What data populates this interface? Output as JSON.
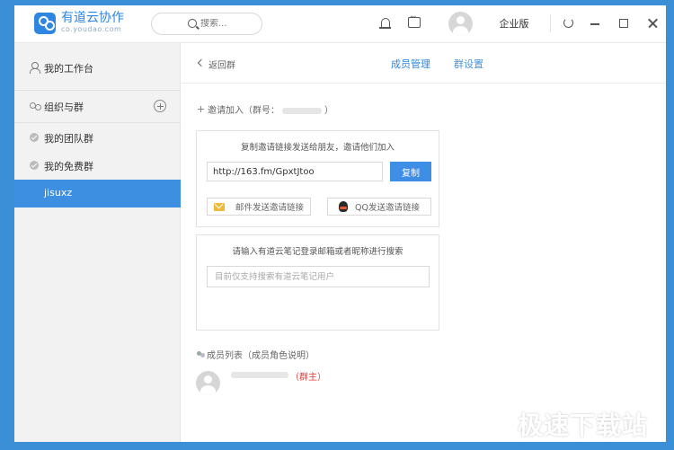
{
  "app": {
    "logo_title": "有道云协作",
    "logo_sub": "co.youdao.com",
    "search_placeholder": "搜索...",
    "edition_label": "企业版"
  },
  "sidebar": {
    "workspace": "我的工作台",
    "org_groups": "组织与群",
    "items": [
      {
        "label": "我的团队群"
      },
      {
        "label": "我的免费群"
      },
      {
        "label": "jisuxz"
      }
    ]
  },
  "main": {
    "back_label": "返回群",
    "tabs": [
      {
        "label": "成员管理"
      },
      {
        "label": "群设置"
      }
    ],
    "invite": {
      "title_prefix": "邀请加入（群号：",
      "title_suffix": "）",
      "link_caption": "复制邀请链接发送给朋友，邀请他们加入",
      "link_value": "http://163.fm/GpxtJtoo",
      "copy_label": "复制",
      "mail_label": "邮件发送邀请链接",
      "qq_label": "QQ发送邀请链接"
    },
    "search_card": {
      "caption": "请输入有道云笔记登录邮箱或者昵称进行搜索",
      "placeholder": "目前仅支持搜索有道云笔记用户"
    },
    "members": {
      "title": "成员列表（成员角色说明）",
      "owner_role": "（群主）"
    }
  },
  "watermark": "极速下载站"
}
